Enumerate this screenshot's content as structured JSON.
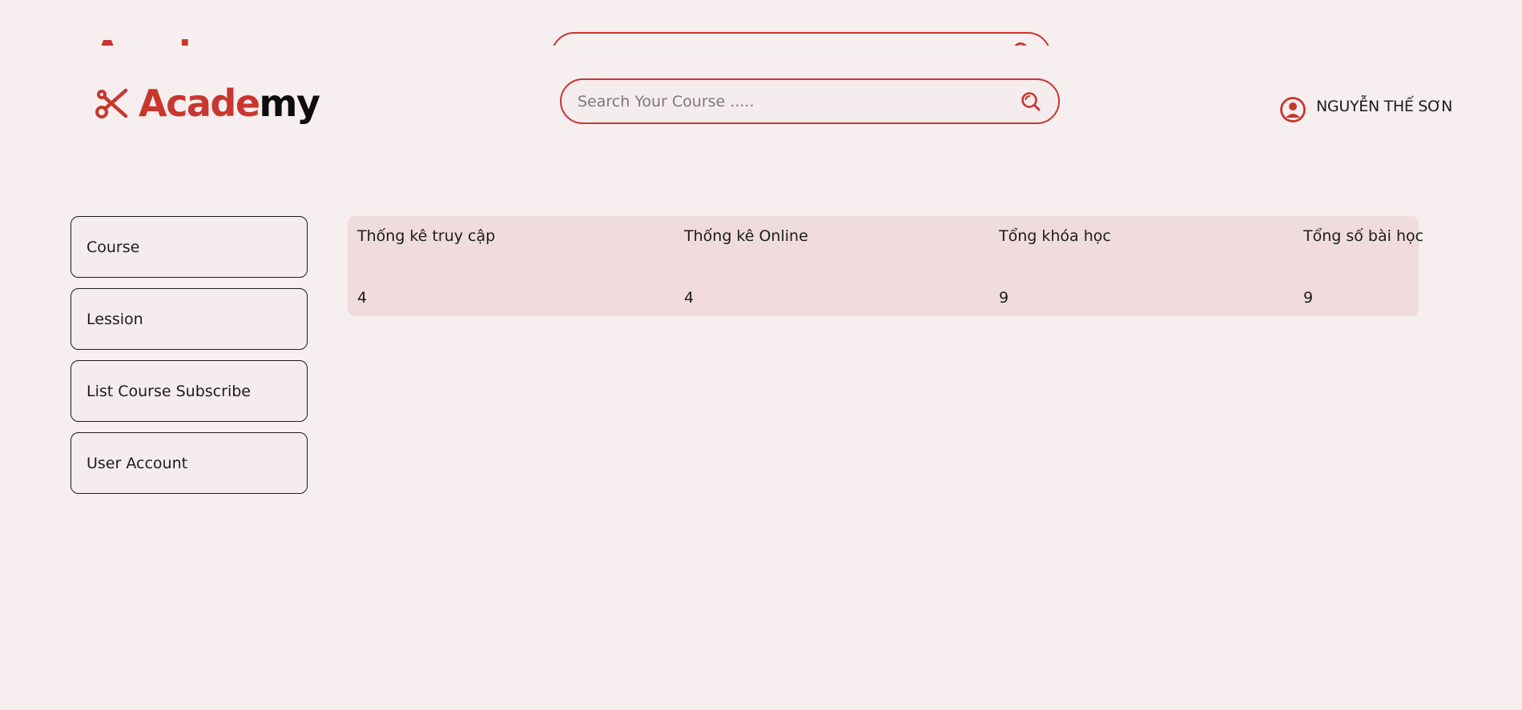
{
  "brand": {
    "logo_red": "Acade",
    "logo_black": "my",
    "accent_color": "#c8372d",
    "logo_icon": "scissors-icon"
  },
  "search": {
    "placeholder": "Search Your Course .....",
    "value": "",
    "icon": "search-icon"
  },
  "user": {
    "name": "NGUYỄN THẾ SƠN",
    "icon": "user-circle-icon"
  },
  "sidebar": {
    "items": [
      {
        "label": "Course"
      },
      {
        "label": "Lession"
      },
      {
        "label": "List Course Subscribe"
      },
      {
        "label": "User Account"
      }
    ]
  },
  "stats": {
    "columns": [
      {
        "label": "Thống kê truy cập",
        "value": "4"
      },
      {
        "label": "Thống kê Online",
        "value": "4"
      },
      {
        "label": "Tổng khóa học",
        "value": "9"
      },
      {
        "label": "Tổng số bài học",
        "value": "9"
      }
    ]
  }
}
